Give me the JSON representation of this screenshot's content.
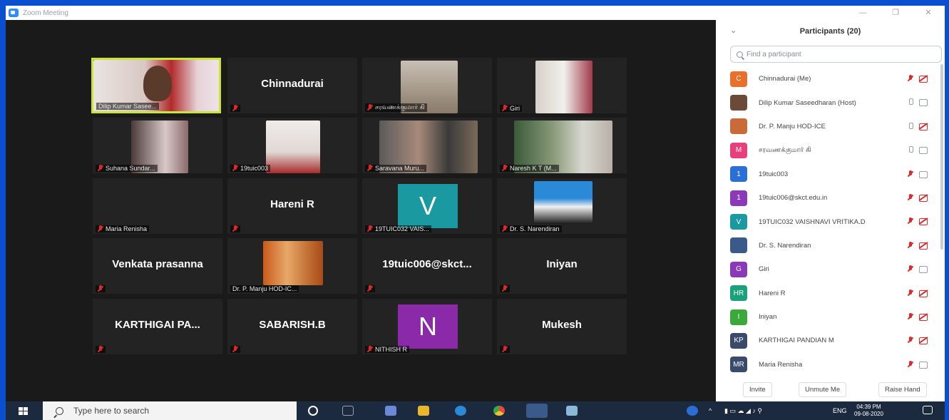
{
  "window": {
    "title": "Zoom Meeting",
    "controls": [
      "—",
      "❐",
      "✕"
    ]
  },
  "gallery": {
    "tiles": [
      {
        "big": "",
        "tag": "Dilip Kumar Sasee..."
      },
      {
        "big": "Chinnadurai",
        "tag": ""
      },
      {
        "big": "",
        "tag": "சரவணக்குமார் கி"
      },
      {
        "big": "",
        "tag": "Giri"
      },
      {
        "big": "",
        "tag": "Suhana Sundar..."
      },
      {
        "big": "",
        "tag": "19tuic003"
      },
      {
        "big": "",
        "tag": "Saravana Muru..."
      },
      {
        "big": "",
        "tag": "Naresh K T (M..."
      },
      {
        "big": "",
        "tag": "Maria Renisha"
      },
      {
        "big": "Hareni R",
        "tag": ""
      },
      {
        "big": "",
        "tag": "19TUIC032 VAIS..."
      },
      {
        "big": "",
        "tag": "Dr. S. Narendiran"
      },
      {
        "big": "Venkata prasanna",
        "tag": ""
      },
      {
        "big": "",
        "tag": "Dr. P. Manju HOD-IC..."
      },
      {
        "big": "19tuic006@skct...",
        "tag": ""
      },
      {
        "big": "Iniyan",
        "tag": ""
      },
      {
        "big": "KARTHIGAI  PA...",
        "tag": ""
      },
      {
        "big": "SABARISH.B",
        "tag": ""
      },
      {
        "big": "",
        "tag": "NITHISH R"
      },
      {
        "big": "Mukesh",
        "tag": ""
      }
    ],
    "avatar_letters": {
      "vaishnavi": "V",
      "nithish": "N"
    },
    "colors": {
      "active_border": "#c9e635",
      "avatar_teal": "#1a9aa0",
      "avatar_purple": "#8a2aa8"
    }
  },
  "participants": {
    "title": "Participants (20)",
    "search_placeholder": "Find a participant",
    "list": [
      {
        "initial": "C",
        "color": "#e8702a",
        "name": "Chinnadurai (Me)",
        "mic": "off",
        "cam": "off"
      },
      {
        "initial": "",
        "color": "#6b4a3a",
        "name": "Dilip Kumar Saseedharan (Host)",
        "mic": "on",
        "cam": "on"
      },
      {
        "initial": "",
        "color": "#c86a3a",
        "name": "Dr. P. Manju HOD-ICE",
        "mic": "on",
        "cam": "off"
      },
      {
        "initial": "M",
        "color": "#e8407a",
        "name": "சரவணக்குமார் கி",
        "mic": "on",
        "cam": "on"
      },
      {
        "initial": "1",
        "color": "#2a6fd6",
        "name": "19tuic003",
        "mic": "off",
        "cam": "on"
      },
      {
        "initial": "1",
        "color": "#8a3ab8",
        "name": "19tuic006@skct.edu.in",
        "mic": "off",
        "cam": "off"
      },
      {
        "initial": "V",
        "color": "#1a9aa0",
        "name": "19TUIC032 VAISHNAVI VRITIKA.D",
        "mic": "off",
        "cam": "off"
      },
      {
        "initial": "",
        "color": "#3a5a8a",
        "name": "Dr. S. Narendiran",
        "mic": "off",
        "cam": "off"
      },
      {
        "initial": "G",
        "color": "#8a3ab8",
        "name": "Giri",
        "mic": "off",
        "cam": "on"
      },
      {
        "initial": "HR",
        "color": "#1aa07a",
        "name": "Hareni R",
        "mic": "off",
        "cam": "off"
      },
      {
        "initial": "I",
        "color": "#3aa83a",
        "name": "Iniyan",
        "mic": "off",
        "cam": "off"
      },
      {
        "initial": "KP",
        "color": "#3a4a6a",
        "name": "KARTHIGAI PANDIAN M",
        "mic": "off",
        "cam": "off"
      },
      {
        "initial": "MR",
        "color": "#3a4a6a",
        "name": "Maria Renisha",
        "mic": "off",
        "cam": "on"
      }
    ],
    "buttons": {
      "invite": "Invite",
      "unmute": "Unmute Me",
      "raise": "Raise Hand"
    }
  },
  "taskbar": {
    "search_placeholder": "Type here to search",
    "lang": "ENG",
    "time": "04:39 PM",
    "date": "09-08-2020"
  }
}
